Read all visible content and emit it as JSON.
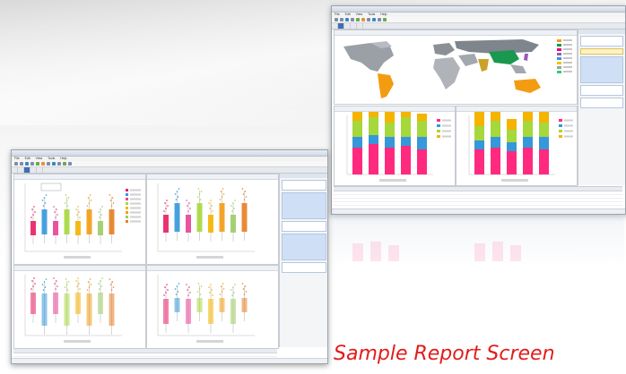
{
  "caption": "Sample Report Screen",
  "right_screen": {
    "title": "",
    "menu": [
      "File",
      "Edit",
      "View",
      "Tools",
      "Help"
    ],
    "tabs": [
      "",
      "",
      "",
      "",
      ""
    ],
    "active_tab": 1,
    "map_legend_colors": [
      "#f39c12",
      "#1a9850",
      "#e4007c",
      "#9b59b6",
      "#3498db",
      "#f1c40f",
      "#95a5a6",
      "#2ecc71"
    ],
    "stacked_series_colors": [
      "#ff2a7f",
      "#3498db",
      "#a6d83c",
      "#f4b400"
    ]
  },
  "left_screen": {
    "title": "",
    "menu": [
      "File",
      "Edit",
      "View",
      "Tools",
      "Help"
    ],
    "tabs": [
      "",
      "",
      "",
      "",
      ""
    ],
    "active_tab": 2,
    "boxplot_colors": [
      "#e91e63",
      "#3498db",
      "#e84393",
      "#a6d83c",
      "#f4b400",
      "#f39c12",
      "#9ccc65",
      "#e67e22"
    ]
  }
}
